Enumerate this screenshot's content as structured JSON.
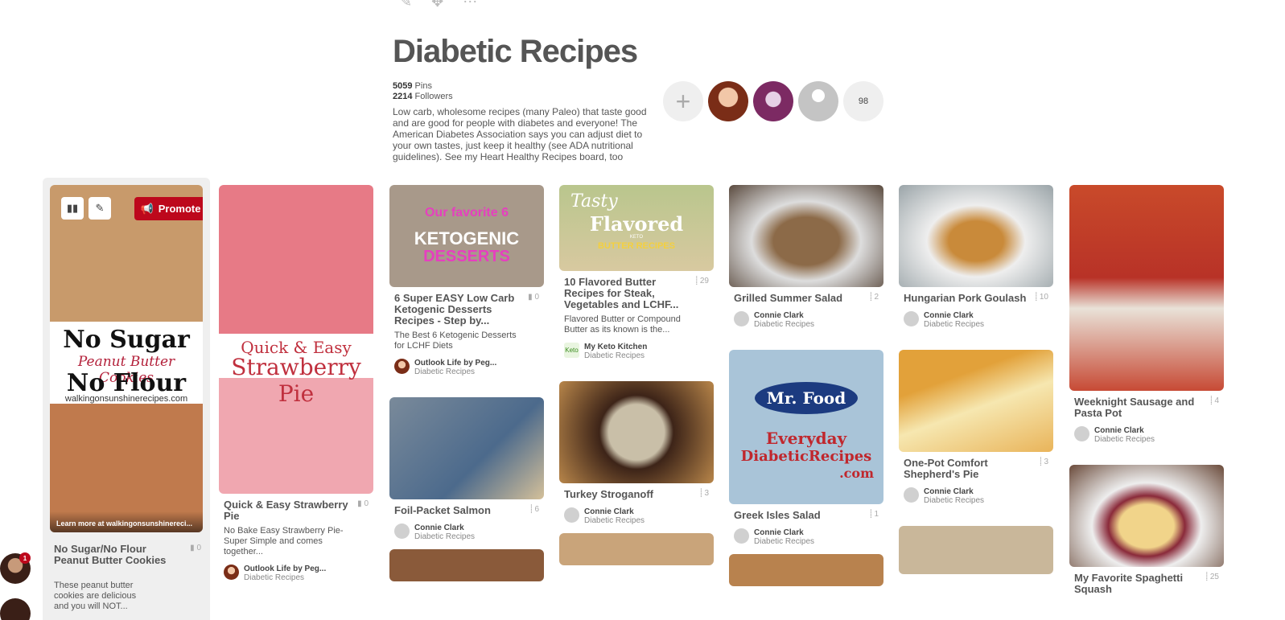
{
  "board": {
    "title": "Diabetic Recipes",
    "pins_count": "5059",
    "pins_label": "Pins",
    "followers_count": "2214",
    "followers_label": "Followers",
    "description": "Low carb, wholesome recipes (many Paleo) that taste good and are good for people with diabetes and everyone! The American Diabetes Association says you can adjust diet to your own tastes, just keep it healthy (see ADA nutritional guidelines). See my Heart Healthy Recipes board, too",
    "collaborators_more": "98"
  },
  "first_pin": {
    "promote_label": "Promote",
    "image_text_1": "No Sugar",
    "image_text_2": "Peanut Butter Cookies",
    "image_text_3": "No Flour",
    "image_text_4": "walkingonsunshinerecipes.com",
    "learn_more": "Learn more at walkingonsunshinereci...",
    "title": "No Sugar/No Flour Peanut Butter Cookies",
    "repins": "0",
    "description": "These peanut butter cookies are delicious and you will NOT..."
  },
  "pins": {
    "strawberry": {
      "image_text": "Quick & Easy",
      "image_text_2": "Strawberry Pie",
      "title": "Quick & Easy Strawberry Pie",
      "repins": "0",
      "description": "No Bake Easy Strawberry Pie- Super Simple and comes together...",
      "pinner": "Outlook Life by Peg...",
      "board": "Diabetic Recipes"
    },
    "keto": {
      "image_text_1": "Our favorite",
      "image_text_2": "6",
      "image_text_3": "KETOGENIC",
      "image_text_4": "DESSERTS",
      "title": "6 Super EASY Low Carb Ketogenic Desserts Recipes - Step by...",
      "repins": "0",
      "description": "The Best 6 Ketogenic Desserts for LCHF Diets",
      "pinner": "Outlook Life by Peg...",
      "board": "Diabetic Recipes"
    },
    "salmon": {
      "title": "Foil-Packet Salmon",
      "repins": "6",
      "pinner": "Connie Clark",
      "board": "Diabetic Recipes"
    },
    "butter": {
      "image_text_1": "Tasty",
      "image_text_2": "Flavored",
      "image_text_3": "KETO",
      "image_text_4": "BUTTER RECIPES",
      "title": "10 Flavored Butter Recipes for Steak, Vegetables and LCHF...",
      "repins": "29",
      "description": "Flavored Butter or Compound Butter as its known is the...",
      "pinner_icon": "Keto",
      "pinner": "My Keto Kitchen",
      "board": "Diabetic Recipes"
    },
    "stroganoff": {
      "title": "Turkey Stroganoff",
      "repins": "3",
      "pinner": "Connie Clark",
      "board": "Diabetic Recipes"
    },
    "grilled": {
      "title": "Grilled Summer Salad",
      "repins": "2",
      "pinner": "Connie Clark",
      "board": "Diabetic Recipes"
    },
    "greek": {
      "image_text_1": "Mr. Food",
      "image_text_2": "Everyday",
      "image_text_3": "DiabeticRecipes",
      "image_text_4": ".com",
      "title": "Greek Isles Salad",
      "repins": "1",
      "pinner": "Connie Clark",
      "board": "Diabetic Recipes"
    },
    "goulash": {
      "title": "Hungarian Pork Goulash",
      "repins": "10",
      "pinner": "Connie Clark",
      "board": "Diabetic Recipes"
    },
    "shepherd": {
      "title": "One-Pot Comfort Shepherd's Pie",
      "repins": "3",
      "pinner": "Connie Clark",
      "board": "Diabetic Recipes"
    },
    "sausage": {
      "title": "Weeknight Sausage and Pasta Pot",
      "repins": "4",
      "pinner": "Connie Clark",
      "board": "Diabetic Recipes"
    },
    "squash": {
      "title": "My Favorite Spaghetti Squash",
      "repins": "25"
    }
  },
  "sidebar": {
    "notification_count": "1"
  },
  "icons": {
    "edit": "pencil-icon",
    "move": "move-icon",
    "more": "more-icon",
    "add": "plus-icon",
    "stats": "stats-icon",
    "pin": "pin-icon"
  },
  "colors": {
    "promote": "#bd081c",
    "background": "#ffffff"
  }
}
